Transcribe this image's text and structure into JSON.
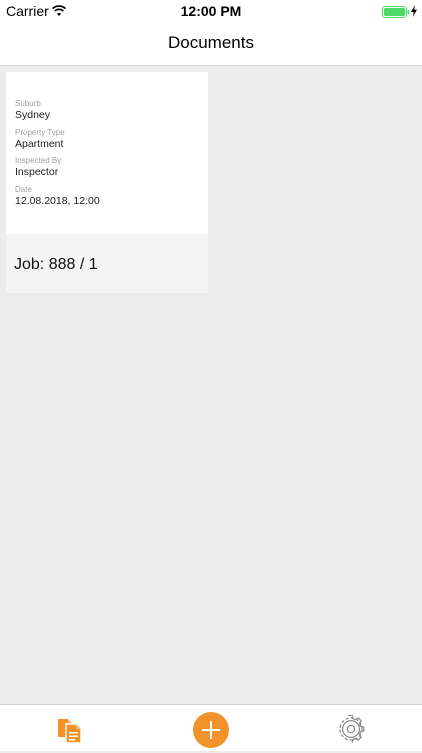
{
  "status_bar": {
    "carrier": "Carrier",
    "time": "12:00 PM",
    "wifi_icon": "wifi-icon",
    "battery_icon": "battery-icon",
    "charging_icon": "charging-bolt-icon"
  },
  "nav": {
    "title": "Documents"
  },
  "card": {
    "fields": [
      {
        "label": "Suburb",
        "value": "Sydney"
      },
      {
        "label": "Property Type",
        "value": "Apartment"
      },
      {
        "label": "Inspected By",
        "value": "Inspector"
      },
      {
        "label": "Date",
        "value": "12.08.2018, 12:00"
      }
    ],
    "job": "Job: 888 / 1"
  },
  "tab_bar": {
    "items": [
      {
        "icon": "documents-icon",
        "active": true
      },
      {
        "icon": "plus-icon",
        "active": false
      },
      {
        "icon": "gear-icon",
        "active": false
      }
    ]
  },
  "colors": {
    "accent": "#f2922b",
    "background": "#ececec",
    "card": "#ffffff",
    "card_footer": "#f4f4f4",
    "battery": "#4cd964"
  }
}
